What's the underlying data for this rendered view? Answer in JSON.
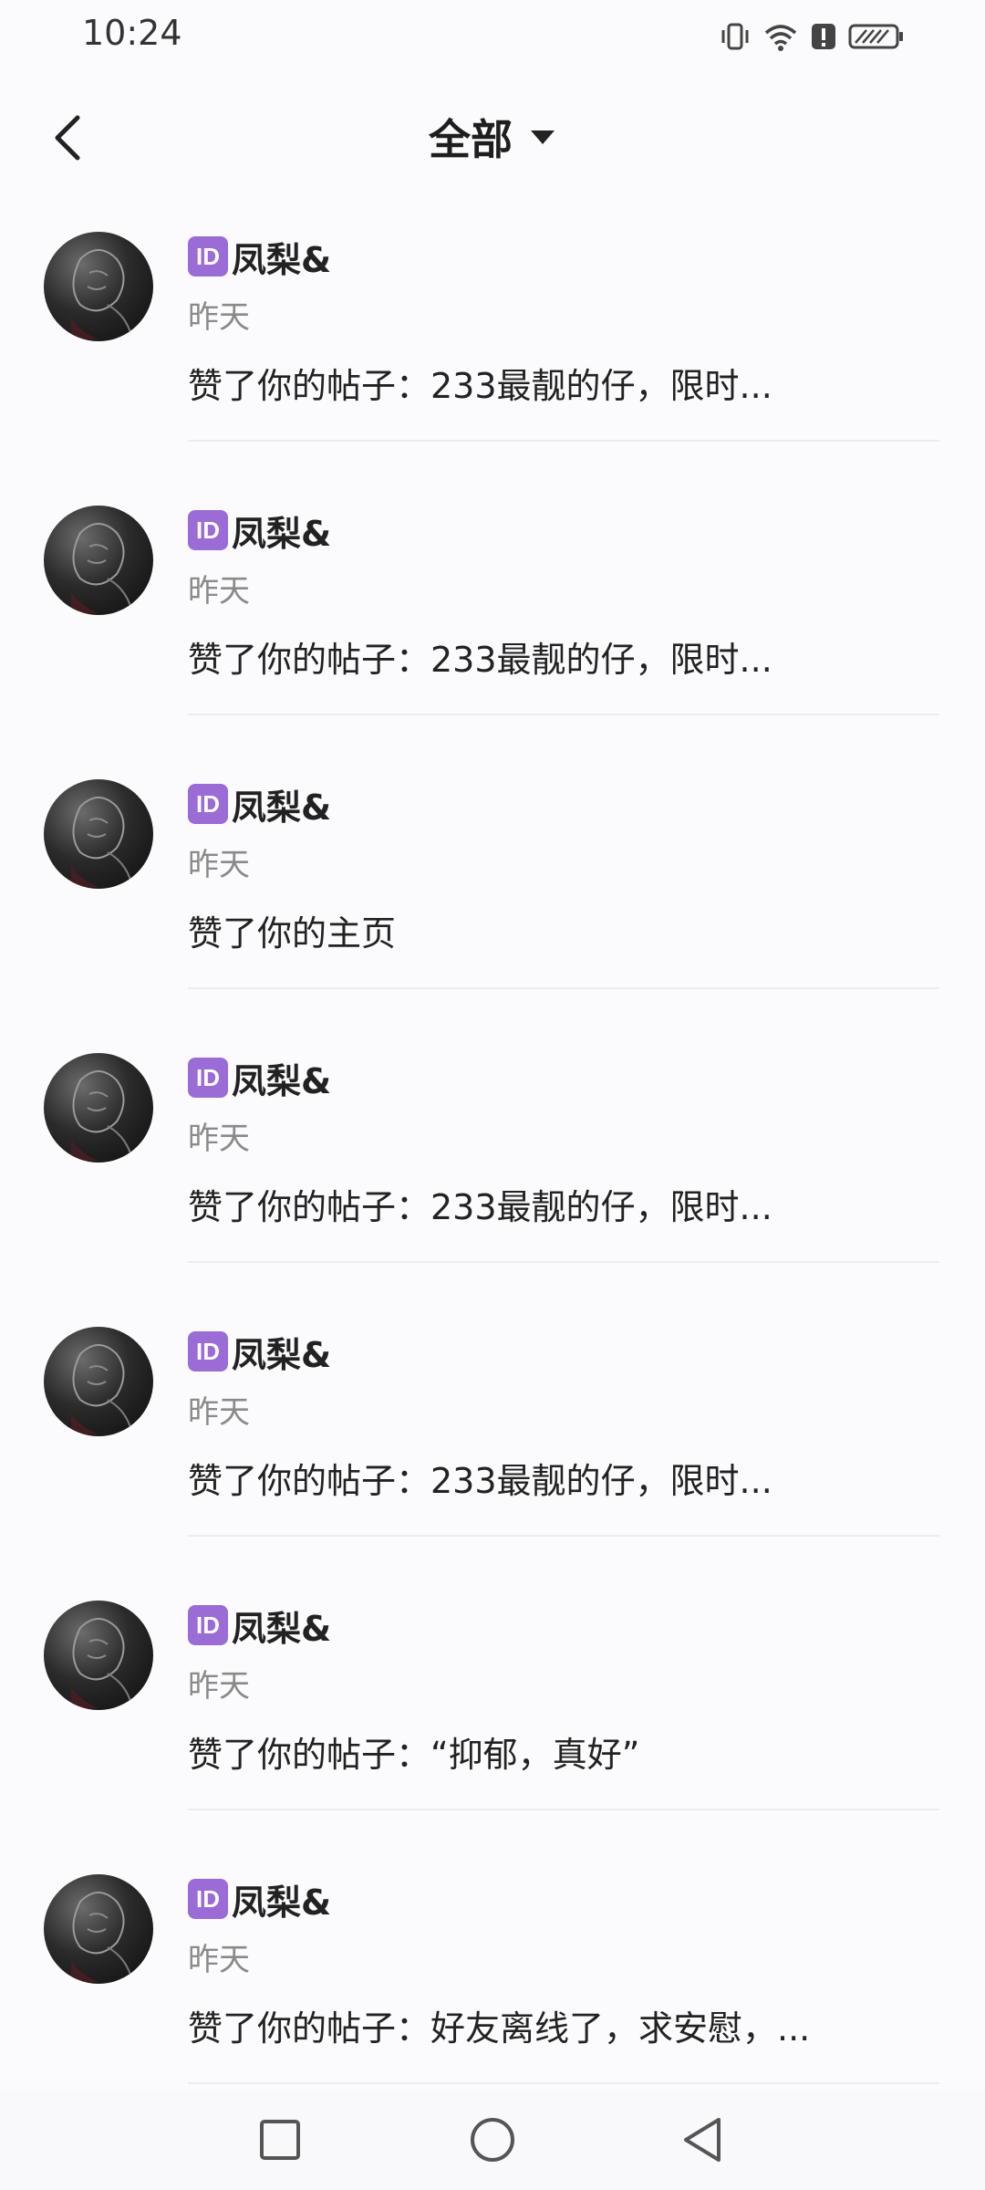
{
  "status_bar": {
    "time": "10:24",
    "icons": [
      "vibrate-icon",
      "wifi-icon",
      "alert-icon",
      "battery-charging-icon"
    ]
  },
  "header": {
    "title": "全部",
    "back_icon": "chevron-left-icon",
    "dropdown_icon": "triangle-down-icon"
  },
  "notifications": [
    {
      "badge": "ID",
      "user": "凤梨&",
      "time": "昨天",
      "text": "赞了你的帖子：233最靓的仔，限时..."
    },
    {
      "badge": "ID",
      "user": "凤梨&",
      "time": "昨天",
      "text": "赞了你的帖子：233最靓的仔，限时..."
    },
    {
      "badge": "ID",
      "user": "凤梨&",
      "time": "昨天",
      "text": "赞了你的主页"
    },
    {
      "badge": "ID",
      "user": "凤梨&",
      "time": "昨天",
      "text": "赞了你的帖子：233最靓的仔，限时..."
    },
    {
      "badge": "ID",
      "user": "凤梨&",
      "time": "昨天",
      "text": "赞了你的帖子：233最靓的仔，限时..."
    },
    {
      "badge": "ID",
      "user": "凤梨&",
      "time": "昨天",
      "text": "赞了你的帖子：“抑郁，真好”"
    },
    {
      "badge": "ID",
      "user": "凤梨&",
      "time": "昨天",
      "text": "赞了你的帖子：好友离线了，求安慰，..."
    }
  ],
  "nav_bar": {
    "icons": [
      "recents-square-icon",
      "home-circle-icon",
      "back-triangle-icon"
    ]
  },
  "colors": {
    "badge": "#9b6bd6",
    "background": "#fbfafc",
    "secondary_text": "#8a8a8a"
  }
}
